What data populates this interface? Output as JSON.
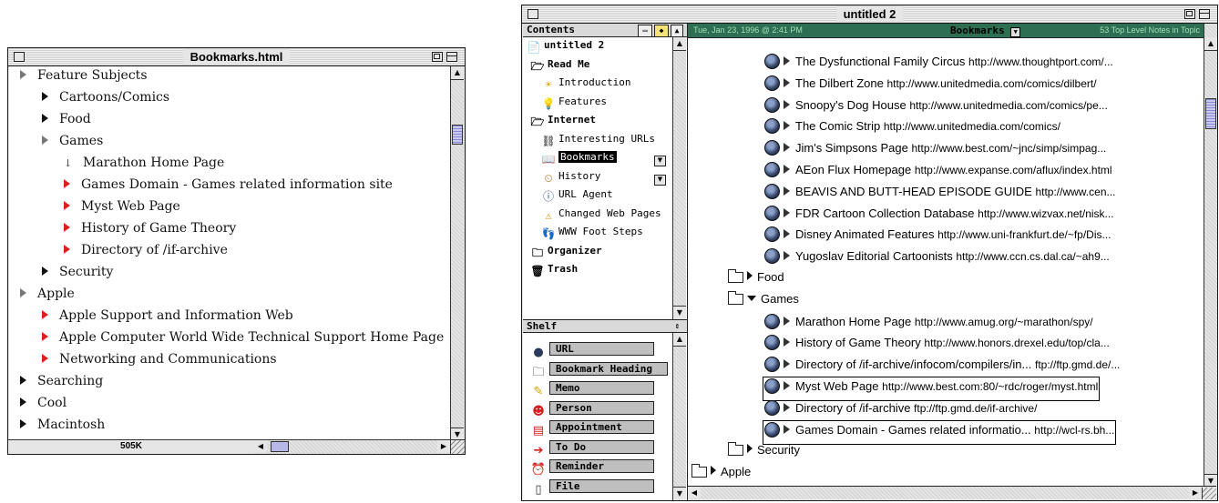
{
  "window1": {
    "title": "Bookmarks.html",
    "status_size": "505K",
    "rows": [
      {
        "text": "Feature Subjects",
        "marker": "gray"
      },
      {
        "text": "Cartoons/Comics",
        "marker": "black"
      },
      {
        "text": "Food",
        "marker": "black"
      },
      {
        "text": "Games",
        "marker": "gray"
      },
      {
        "text": "Marathon Home Page",
        "marker": "down"
      },
      {
        "text": "Games Domain - Games related information site",
        "marker": "red"
      },
      {
        "text": "Myst Web Page",
        "marker": "red"
      },
      {
        "text": "History of Game Theory",
        "marker": "red"
      },
      {
        "text": "Directory of /if-archive",
        "marker": "red"
      },
      {
        "text": "Security",
        "marker": "black"
      },
      {
        "text": "Apple",
        "marker": "gray"
      },
      {
        "text": "Apple Support and Information Web",
        "marker": "red"
      },
      {
        "text": "Apple Computer World Wide Technical Support Home Page",
        "marker": "red"
      },
      {
        "text": "Networking and Communications",
        "marker": "red"
      },
      {
        "text": "Searching",
        "marker": "black"
      },
      {
        "text": "Cool",
        "marker": "black"
      },
      {
        "text": "Macintosh",
        "marker": "black"
      }
    ]
  },
  "window2": {
    "title": "untitled 2",
    "contents_label": "Contents",
    "shelf_label": "Shelf",
    "tree": [
      {
        "text": "untitled 2",
        "icon": "document-icon",
        "bold": true
      },
      {
        "text": "Read Me",
        "icon": "folder-open-icon",
        "bold": true
      },
      {
        "text": "Introduction",
        "icon": "sun-icon",
        "bold": false
      },
      {
        "text": "Features",
        "icon": "lightbulb-icon",
        "bold": false
      },
      {
        "text": "Internet",
        "icon": "folder-open-icon",
        "bold": true
      },
      {
        "text": "Interesting URLs",
        "icon": "link-icon",
        "bold": false
      },
      {
        "text": "Bookmarks",
        "icon": "book-icon",
        "bold": false,
        "selected": true
      },
      {
        "text": "History",
        "icon": "clock-icon",
        "bold": false
      },
      {
        "text": "URL Agent",
        "icon": "agent-icon",
        "bold": false
      },
      {
        "text": "Changed Web Pages",
        "icon": "warning-icon",
        "bold": false
      },
      {
        "text": "WWW Foot Steps",
        "icon": "footsteps-icon",
        "bold": false
      },
      {
        "text": "Organizer",
        "icon": "folder-icon",
        "bold": true
      },
      {
        "text": "Trash",
        "icon": "trash-icon",
        "bold": true
      }
    ],
    "shelf": [
      {
        "text": "URL",
        "icon": "globe-icon",
        "color": "#2a3a5c"
      },
      {
        "text": "Bookmark Heading",
        "icon": "folder-icon",
        "color": "#000000"
      },
      {
        "text": "Memo",
        "icon": "pencil-icon",
        "color": "#c8a000"
      },
      {
        "text": "Person",
        "icon": "person-icon",
        "color": "#d02020"
      },
      {
        "text": "Appointment",
        "icon": "calendar-icon",
        "color": "#d02020"
      },
      {
        "text": "To Do",
        "icon": "arrow-icon",
        "color": "#d02020"
      },
      {
        "text": "Reminder",
        "icon": "alarm-icon",
        "color": "#d02020"
      },
      {
        "text": "File",
        "icon": "file-icon",
        "color": "#333333"
      }
    ],
    "header": {
      "date": "Tue, Jan 23, 1996 @ 2:41 PM",
      "topic": "Bookmarks",
      "count": "53 Top Level Notes in Topic"
    },
    "rows": [
      {
        "kind": "url",
        "name": "The Dysfunctional Family Circus",
        "url": "http://www.thoughtport.com/..."
      },
      {
        "kind": "url",
        "name": "The Dilbert Zone",
        "url": "http://www.unitedmedia.com/comics/dilbert/"
      },
      {
        "kind": "url",
        "name": "Snoopy's Dog House",
        "url": "http://www.unitedmedia.com/comics/pe..."
      },
      {
        "kind": "url",
        "name": "The Comic Strip",
        "url": "http://www.unitedmedia.com/comics/"
      },
      {
        "kind": "url",
        "name": "Jim's Simpsons Page",
        "url": "http://www.best.com/~jnc/simp/simpag..."
      },
      {
        "kind": "url",
        "name": "AEon Flux Homepage",
        "url": "http://www.expanse.com/aflux/index.html"
      },
      {
        "kind": "url",
        "name": "BEAVIS AND BUTT-HEAD EPISODE GUIDE",
        "url": "http://www.cen..."
      },
      {
        "kind": "url",
        "name": "FDR Cartoon Collection Database",
        "url": "http://www.wizvax.net/nisk..."
      },
      {
        "kind": "url",
        "name": "Disney Animated Features",
        "url": "http://www.uni-frankfurt.de/~fp/Dis..."
      },
      {
        "kind": "url",
        "name": "Yugoslav Editorial Cartoonists",
        "url": "http://www.ccn.cs.dal.ca/~ah9..."
      },
      {
        "kind": "folder",
        "name": "Food",
        "open": false
      },
      {
        "kind": "folder",
        "name": "Games",
        "open": true
      },
      {
        "kind": "url",
        "name": "Marathon Home Page",
        "url": "http://www.amug.org/~marathon/spy/"
      },
      {
        "kind": "url",
        "name": "History of Game Theory",
        "url": "http://www.honors.drexel.edu/top/cla..."
      },
      {
        "kind": "url",
        "name": "Directory of /if-archive/infocom/compilers/in...",
        "url": "ftp://ftp.gmd.de/..."
      },
      {
        "kind": "url",
        "name": "Myst Web Page",
        "url": "http://www.best.com:80/~rdc/roger/myst.html",
        "boxed": true
      },
      {
        "kind": "url",
        "name": "Directory of /if-archive",
        "url": "ftp://ftp.gmd.de/if-archive/"
      },
      {
        "kind": "url",
        "name": "Games Domain - Games related informatio...",
        "url": "http://wcl-rs.bh...",
        "boxed": true
      },
      {
        "kind": "folder",
        "name": "Security",
        "open": false
      },
      {
        "kind": "folder",
        "name": "Apple",
        "open": false,
        "top_level": true
      }
    ]
  }
}
